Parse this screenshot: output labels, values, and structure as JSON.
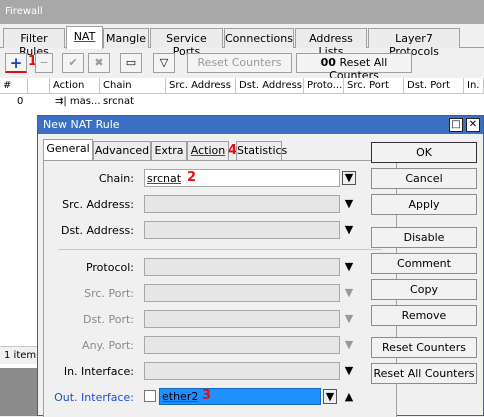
{
  "window": {
    "title": "Firewall"
  },
  "tabs": [
    "Filter Rules",
    "NAT",
    "Mangle",
    "Service Ports",
    "Connections",
    "Address Lists",
    "Layer7 Protocols"
  ],
  "toolbar": {
    "add_glyph": "+",
    "remove_glyph": "−",
    "enable_glyph": "✔",
    "disable_glyph": "✖",
    "comment_glyph": "▭",
    "filter_glyph": "▽",
    "reset_counters": "Reset Counters",
    "reset_all_prefix": "00",
    "reset_all_counters": "Reset All Counters",
    "marker1": "1"
  },
  "table": {
    "headers": [
      "#",
      "",
      "Action",
      "Chain",
      "Src. Address",
      "Dst. Address",
      "Proto...",
      "Src. Port",
      "Dst. Port",
      "In."
    ],
    "rows": [
      {
        "num": "0",
        "action": "⇉| mas...",
        "chain": "srcnat"
      }
    ],
    "count": "1 item"
  },
  "dialog": {
    "title": "New NAT Rule",
    "tabs": [
      "General",
      "Advanced",
      "Extra",
      "Action",
      "Statistics"
    ],
    "marker4": "4",
    "fields": {
      "chain_label": "Chain:",
      "chain_value": "srcnat",
      "marker2": "2",
      "src_address_label": "Src. Address:",
      "dst_address_label": "Dst. Address:",
      "protocol_label": "Protocol:",
      "src_port_label": "Src. Port:",
      "dst_port_label": "Dst. Port:",
      "any_port_label": "Any. Port:",
      "in_interface_label": "In. Interface:",
      "out_interface_label": "Out. Interface:",
      "out_interface_value": "ether2",
      "marker3": "3"
    },
    "buttons": [
      "OK",
      "Cancel",
      "Apply",
      "Disable",
      "Comment",
      "Copy",
      "Remove",
      "Reset Counters",
      "Reset All Counters"
    ]
  },
  "colors": {
    "title_blue": "#3b6fc4",
    "highlight": "#1e90ff",
    "marker_red": "#e01010"
  }
}
